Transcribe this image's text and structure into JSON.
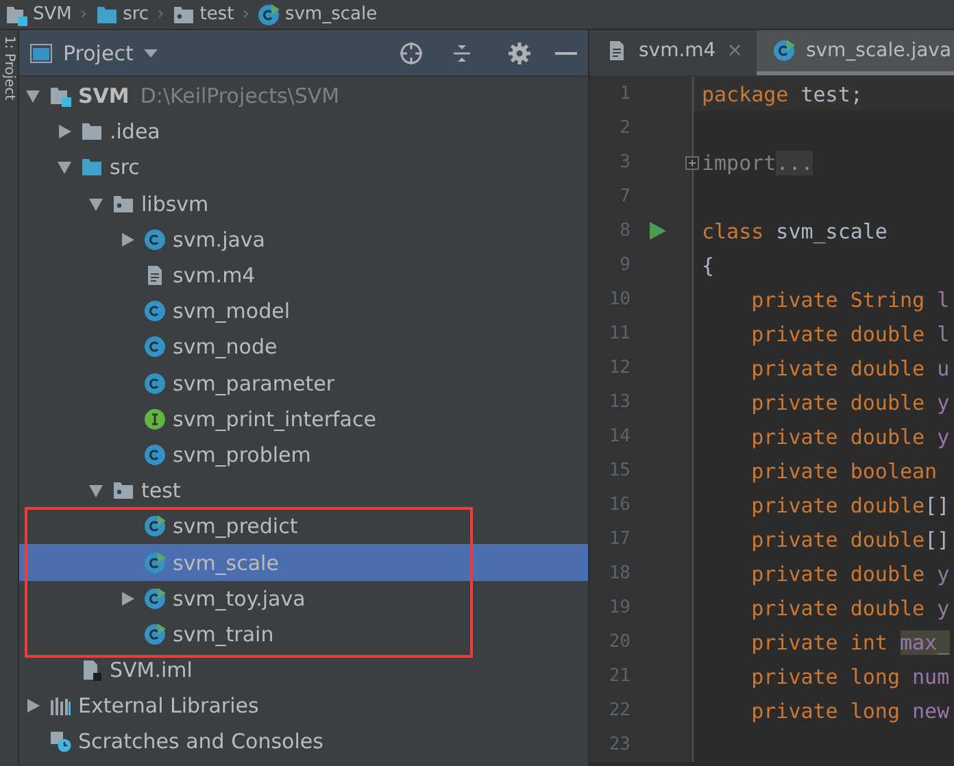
{
  "breadcrumb": {
    "separator": "›",
    "items": [
      {
        "label": "SVM",
        "kind": "module"
      },
      {
        "label": "src",
        "kind": "folder"
      },
      {
        "label": "test",
        "kind": "package"
      },
      {
        "label": "svm_scale",
        "kind": "runnable_class"
      }
    ]
  },
  "side_strip": {
    "label": "1: Project"
  },
  "project_panel": {
    "title": "Project",
    "tree": [
      {
        "label": "SVM",
        "hint": "D:\\KeilProjects\\SVM",
        "kind": "module",
        "expanded": true,
        "selected": false,
        "children": [
          {
            "label": ".idea",
            "kind": "folder_plain",
            "expanded": false,
            "selected": false
          },
          {
            "label": "src",
            "kind": "folder",
            "expanded": true,
            "selected": false,
            "children": [
              {
                "label": "libsvm",
                "kind": "package",
                "expanded": true,
                "selected": false,
                "children": [
                  {
                    "label": "svm.java",
                    "kind": "class",
                    "expanded": false,
                    "selected": false
                  },
                  {
                    "label": "svm.m4",
                    "kind": "file",
                    "selected": false
                  },
                  {
                    "label": "svm_model",
                    "kind": "class",
                    "selected": false
                  },
                  {
                    "label": "svm_node",
                    "kind": "class",
                    "selected": false
                  },
                  {
                    "label": "svm_parameter",
                    "kind": "class",
                    "selected": false
                  },
                  {
                    "label": "svm_print_interface",
                    "kind": "interface",
                    "selected": false
                  },
                  {
                    "label": "svm_problem",
                    "kind": "class",
                    "selected": false
                  }
                ]
              },
              {
                "label": "test",
                "kind": "package",
                "expanded": true,
                "selected": false,
                "children": [
                  {
                    "label": "svm_predict",
                    "kind": "runnable_class",
                    "selected": false
                  },
                  {
                    "label": "svm_scale",
                    "kind": "runnable_class",
                    "selected": true
                  },
                  {
                    "label": "svm_toy.java",
                    "kind": "runnable_class",
                    "expanded": false,
                    "selected": false
                  },
                  {
                    "label": "svm_train",
                    "kind": "runnable_class",
                    "selected": false
                  }
                ]
              }
            ]
          },
          {
            "label": "SVM.iml",
            "kind": "iml",
            "selected": false
          }
        ]
      },
      {
        "label": "External Libraries",
        "kind": "libraries",
        "expanded": false,
        "selected": false
      },
      {
        "label": "Scratches and Consoles",
        "kind": "scratches",
        "selected": false
      }
    ]
  },
  "annotation_frame": true,
  "editor": {
    "tabs": [
      {
        "label": "svm.m4",
        "kind": "file",
        "close_glyph": "×",
        "selected": false
      },
      {
        "label": "svm_scale.java",
        "kind": "runnable_class",
        "selected": true
      }
    ],
    "lines": [
      {
        "number": "1",
        "current": true,
        "tokens": [
          {
            "kind": "keyword",
            "text": "package"
          },
          {
            "kind": "plain",
            "text": " test;"
          }
        ]
      },
      {
        "number": "2"
      },
      {
        "number": "3",
        "folded": true,
        "tokens": [
          {
            "kind": "comment",
            "text": "import"
          },
          {
            "kind": "fold",
            "text": "..."
          }
        ]
      },
      {
        "number": "7"
      },
      {
        "number": "8",
        "runnable": true,
        "tokens": [
          {
            "kind": "keyword",
            "text": "class"
          },
          {
            "kind": "plain",
            "text": " svm_scale"
          }
        ]
      },
      {
        "number": "9",
        "tokens": [
          {
            "kind": "plain",
            "text": "{"
          }
        ]
      },
      {
        "number": "10",
        "tokens": [
          {
            "kind": "keyword",
            "text": "    private String"
          },
          {
            "kind": "field",
            "text": " l"
          }
        ]
      },
      {
        "number": "11",
        "tokens": [
          {
            "kind": "keyword",
            "text": "    private double"
          },
          {
            "kind": "field",
            "text": " l"
          }
        ]
      },
      {
        "number": "12",
        "tokens": [
          {
            "kind": "keyword",
            "text": "    private double"
          },
          {
            "kind": "field",
            "text": " u"
          }
        ]
      },
      {
        "number": "13",
        "tokens": [
          {
            "kind": "keyword",
            "text": "    private double"
          },
          {
            "kind": "field",
            "text": " y"
          }
        ]
      },
      {
        "number": "14",
        "tokens": [
          {
            "kind": "keyword",
            "text": "    private double"
          },
          {
            "kind": "field",
            "text": " y"
          }
        ]
      },
      {
        "number": "15",
        "tokens": [
          {
            "kind": "keyword",
            "text": "    private boolean"
          }
        ]
      },
      {
        "number": "16",
        "tokens": [
          {
            "kind": "keyword",
            "text": "    private double"
          },
          {
            "kind": "plain",
            "text": "[]"
          }
        ]
      },
      {
        "number": "17",
        "tokens": [
          {
            "kind": "keyword",
            "text": "    private double"
          },
          {
            "kind": "plain",
            "text": "[]"
          }
        ]
      },
      {
        "number": "18",
        "tokens": [
          {
            "kind": "keyword",
            "text": "    private double"
          },
          {
            "kind": "field",
            "text": " y"
          }
        ]
      },
      {
        "number": "19",
        "tokens": [
          {
            "kind": "keyword",
            "text": "    private double"
          },
          {
            "kind": "field",
            "text": " y"
          }
        ]
      },
      {
        "number": "20",
        "tokens": [
          {
            "kind": "keyword",
            "text": "    private int "
          },
          {
            "kind": "match",
            "text": "max_"
          }
        ]
      },
      {
        "number": "21",
        "tokens": [
          {
            "kind": "keyword",
            "text": "    private long"
          },
          {
            "kind": "field",
            "text": " num"
          }
        ]
      },
      {
        "number": "22",
        "tokens": [
          {
            "kind": "keyword",
            "text": "    private long"
          },
          {
            "kind": "field",
            "text": " new"
          }
        ]
      },
      {
        "number": "23"
      }
    ]
  }
}
